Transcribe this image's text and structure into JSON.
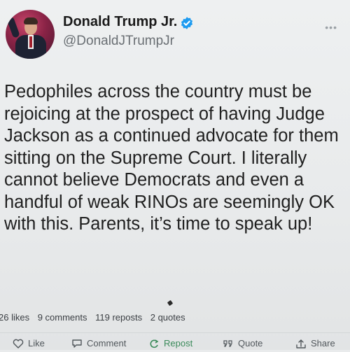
{
  "author": {
    "display_name": "Donald Trump Jr.",
    "handle": "@DonaldJTrumpJr",
    "verified": true
  },
  "post": {
    "text": "Pedophiles across the country must be rejoicing at the prospect of having Judge Jackson as a continued advocate for them sitting on the Supreme Court. I literally cannot believe Democrats and even a handful of weak RINOs are seemingly OK with this. Parents, it’s time to speak up!"
  },
  "stats": {
    "likes": "26 likes",
    "comments": "9 comments",
    "reposts": "119 reposts",
    "quotes": "2 quotes"
  },
  "actions": {
    "like": "Like",
    "comment": "Comment",
    "repost": "Repost",
    "quote": "Quote",
    "share": "Share"
  },
  "colors": {
    "verified_badge": "#1d9bf0",
    "repost_accent": "#3a8a5a"
  },
  "icons": {
    "more": "more-options-icon",
    "like": "like-icon",
    "comment": "comment-icon",
    "repost": "repost-icon",
    "quote": "quote-icon",
    "share": "share-icon"
  }
}
